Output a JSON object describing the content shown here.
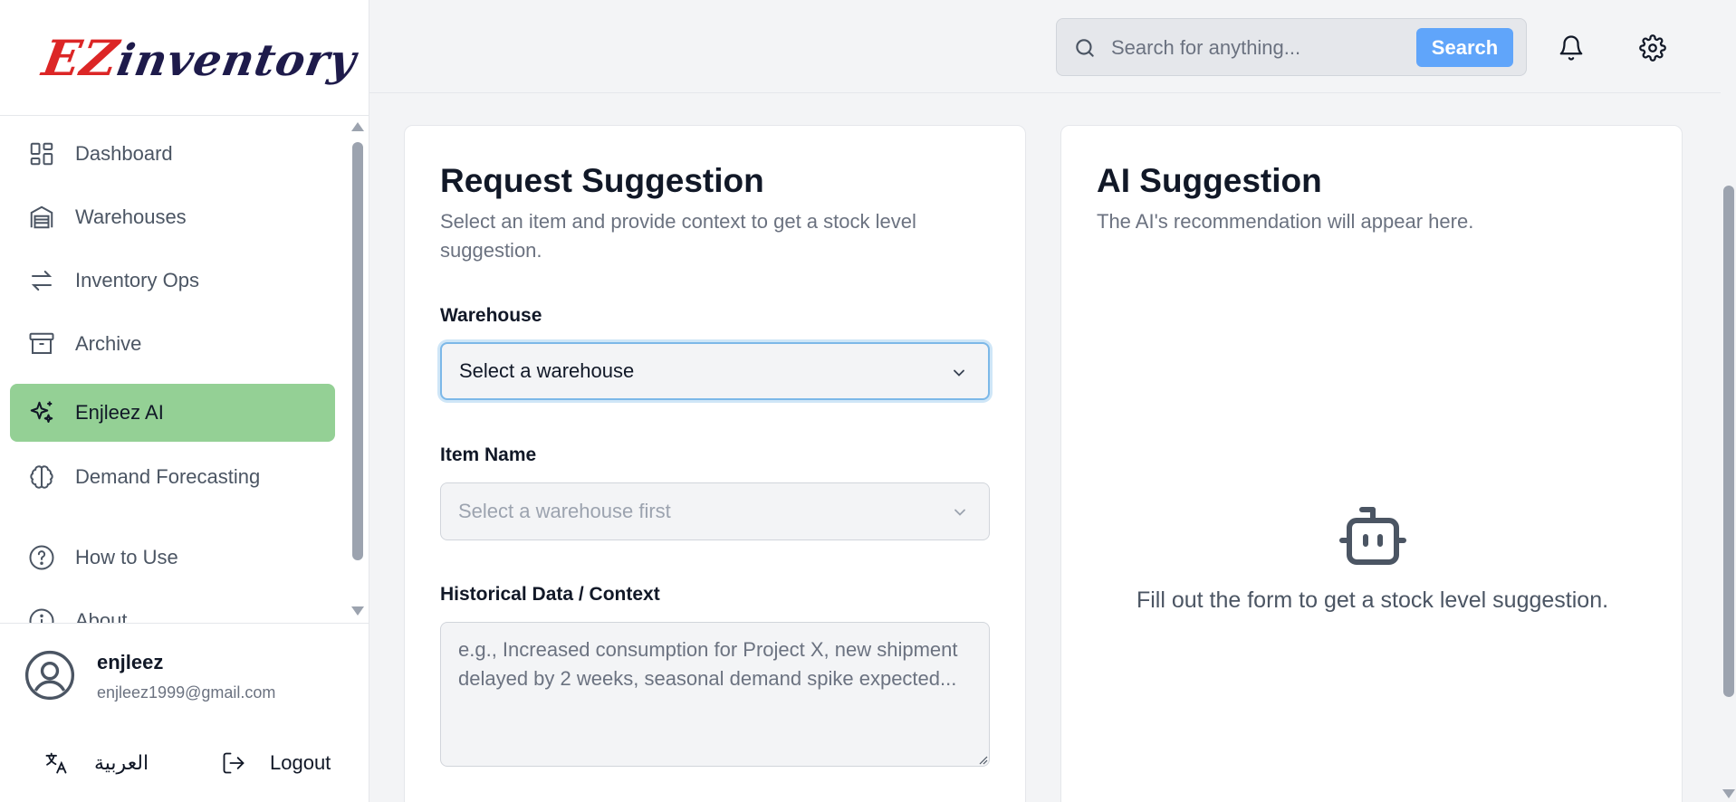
{
  "brand": {
    "logo_ez": "EZ",
    "logo_rest": "inventory",
    "logo_colors": {
      "ez": "#dc2626",
      "rest": "#1e1b4b"
    }
  },
  "sidebar": {
    "items": [
      {
        "label": "Dashboard",
        "icon": "dashboard-icon",
        "active": false
      },
      {
        "label": "Warehouses",
        "icon": "warehouse-icon",
        "active": false
      },
      {
        "label": "Inventory Ops",
        "icon": "arrows-exchange-icon",
        "active": false
      },
      {
        "label": "Archive",
        "icon": "archive-box-icon",
        "active": false
      },
      {
        "label": "Enjleez AI",
        "icon": "sparkles-icon",
        "active": true
      },
      {
        "label": "Demand Forecasting",
        "icon": "brain-icon",
        "active": false
      },
      {
        "label": "How to Use",
        "icon": "help-circle-icon",
        "active": false
      },
      {
        "label": "About",
        "icon": "info-circle-icon",
        "active": false
      }
    ],
    "active_color": "#94d095"
  },
  "user": {
    "name": "enjleez",
    "email": "enjleez1999@gmail.com",
    "language_label": "العربية",
    "logout_label": "Logout"
  },
  "header": {
    "search_placeholder": "Search for anything...",
    "search_button": "Search",
    "search_button_color": "#60a5fa"
  },
  "request_card": {
    "title": "Request Suggestion",
    "subtitle": "Select an item and provide context to get a stock level suggestion.",
    "warehouse_label": "Warehouse",
    "warehouse_value": "Select a warehouse",
    "item_label": "Item Name",
    "item_value": "Select a warehouse first",
    "context_label": "Historical Data / Context",
    "context_placeholder": "e.g., Increased consumption for Project X, new shipment delayed by 2 weeks, seasonal demand spike expected..."
  },
  "ai_card": {
    "title": "AI Suggestion",
    "subtitle": "The AI's recommendation will appear here.",
    "empty_text": "Fill out the form to get a stock level suggestion."
  }
}
